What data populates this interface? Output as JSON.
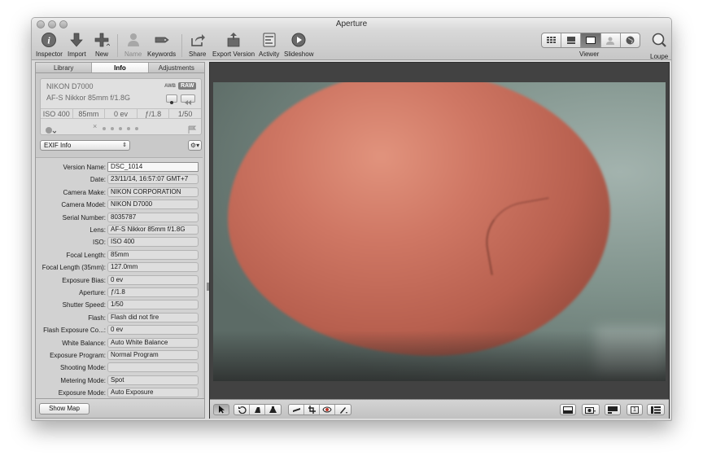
{
  "window": {
    "title": "Aperture"
  },
  "toolbar": {
    "inspector": "Inspector",
    "import": "Import",
    "new": "New",
    "name": "Name",
    "keywords": "Keywords",
    "share": "Share",
    "export_version": "Export Version",
    "activity": "Activity",
    "slideshow": "Slideshow",
    "viewer": "Viewer",
    "loupe": "Loupe"
  },
  "tabs": [
    "Library",
    "Info",
    "Adjustments"
  ],
  "active_tab": "Info",
  "camera": {
    "model": "NIKON D7000",
    "lens": "AF-S Nikkor 85mm f/1.8G",
    "awb": "AWB",
    "raw": "RAW",
    "iso": "ISO 400",
    "focal": "85mm",
    "ev": "0 ev",
    "aperture": "ƒ/1.8",
    "shutter": "1/50",
    "reject_mark": "×"
  },
  "metadata_view": {
    "selected": "EXIF Info"
  },
  "metadata": [
    {
      "label": "Version Name:",
      "value": "DSC_1014"
    },
    {
      "label": "Date:",
      "value": "23/11/14, 16:57:07 GMT+7"
    },
    {
      "label": "Camera Make:",
      "value": "NIKON CORPORATION"
    },
    {
      "label": "Camera Model:",
      "value": "NIKON D7000"
    },
    {
      "label": "Serial Number:",
      "value": "8035787"
    },
    {
      "label": "Lens:",
      "value": "AF-S Nikkor 85mm f/1.8G"
    },
    {
      "label": "ISO:",
      "value": "ISO 400"
    },
    {
      "label": "Focal Length:",
      "value": "85mm"
    },
    {
      "label": "Focal Length (35mm):",
      "value": "127.0mm"
    },
    {
      "label": "Exposure Bias:",
      "value": "0 ev"
    },
    {
      "label": "Aperture:",
      "value": "ƒ/1.8"
    },
    {
      "label": "Shutter Speed:",
      "value": "1/50"
    },
    {
      "label": "Flash:",
      "value": "Flash did not fire"
    },
    {
      "label": "Flash Exposure Co...:",
      "value": "0 ev"
    },
    {
      "label": "White Balance:",
      "value": "Auto White Balance"
    },
    {
      "label": "Exposure Program:",
      "value": "Normal Program"
    },
    {
      "label": "Shooting Mode:",
      "value": ""
    },
    {
      "label": "Metering Mode:",
      "value": "Spot"
    },
    {
      "label": "Exposure Mode:",
      "value": "Auto Exposure"
    }
  ],
  "footer": {
    "show_map": "Show Map",
    "page_indicator": "1"
  },
  "icons": {
    "inspector": "info-circle-icon",
    "import": "down-arrow-icon",
    "new": "plus-icon",
    "name": "person-icon",
    "keywords": "tag-icon",
    "share": "share-icon",
    "export": "export-icon",
    "activity": "activity-icon",
    "slideshow": "play-circle-icon",
    "loupe": "magnifier-icon"
  },
  "colors": {
    "viewer_bg": "#424242",
    "sidebar_bg": "#c9c9c9",
    "chrome": "#d6d6d6"
  }
}
